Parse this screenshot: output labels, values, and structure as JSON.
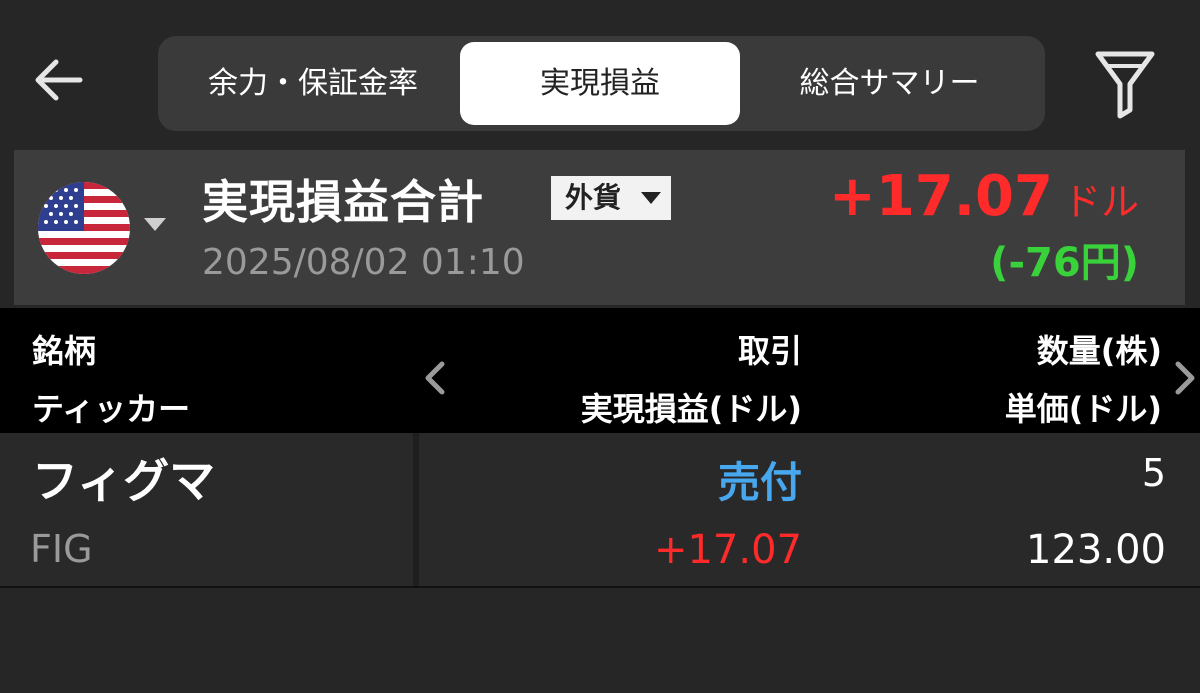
{
  "tabs": [
    {
      "label": "余力・保証金率"
    },
    {
      "label": "実現損益"
    },
    {
      "label": "総合サマリー"
    }
  ],
  "summary": {
    "title": "実現損益合計",
    "currency_badge": "外貨",
    "date": "2025/08/02 01:10",
    "amount": "+17.07",
    "amount_unit": "ドル",
    "yen": "(-76円)"
  },
  "columns": {
    "left_top": "銘柄",
    "left_bottom": "ティッカー",
    "mid_top": "取引",
    "mid_bottom": "実現損益(ドル)",
    "right_top": "数量(株)",
    "right_bottom": "単価(ドル)"
  },
  "rows": [
    {
      "name": "フィグマ",
      "ticker": "FIG",
      "trade": "売付",
      "pl": "+17.07",
      "qty": "5",
      "price": "123.00"
    }
  ],
  "colors": {
    "background": "#262626",
    "profit": "#ff2a2a",
    "yen_loss": "#39d23a",
    "sell": "#48a8ef"
  },
  "icons": [
    "back-arrow-icon",
    "filter-icon",
    "us-flag-icon",
    "caret-down-icon",
    "chevron-left-icon",
    "chevron-right-icon"
  ]
}
